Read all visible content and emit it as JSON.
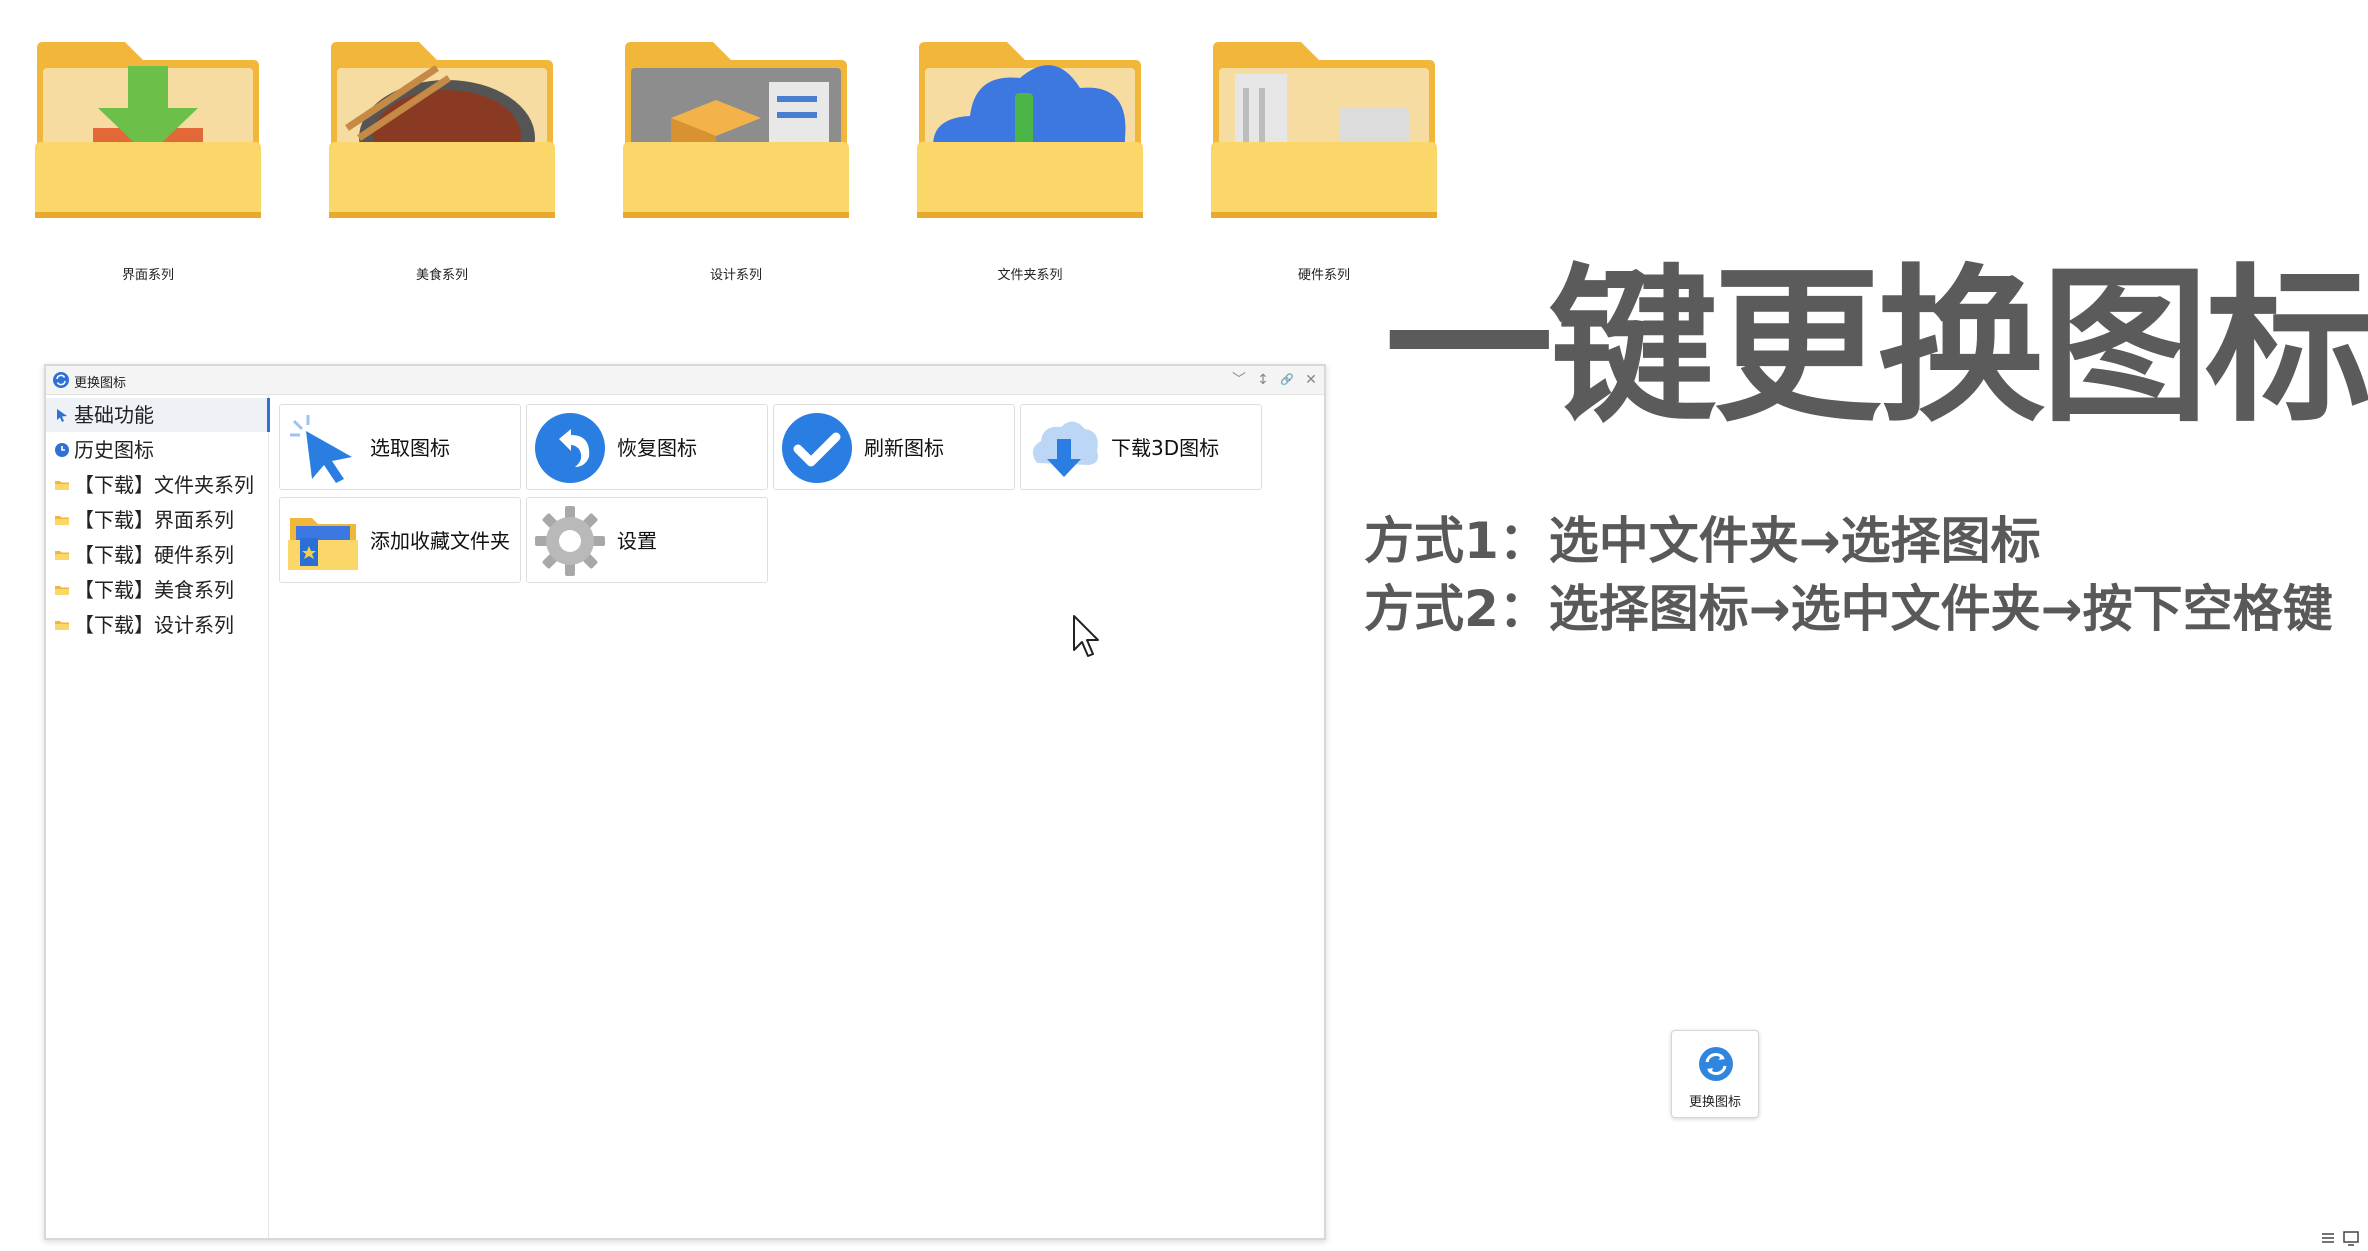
{
  "desktop": {
    "folders": [
      {
        "label": "界面系列",
        "icon": "folder-download-icon"
      },
      {
        "label": "美食系列",
        "icon": "folder-food-icon"
      },
      {
        "label": "设计系列",
        "icon": "folder-design-icon"
      },
      {
        "label": "文件夹系列",
        "icon": "folder-cloud-icon"
      },
      {
        "label": "硬件系列",
        "icon": "folder-hardware-icon"
      }
    ]
  },
  "window": {
    "title": "更换图标",
    "controls": [
      "﹀",
      "↕",
      "🔗",
      "✕"
    ],
    "sidebar": [
      {
        "label": "基础功能",
        "active": true
      },
      {
        "label": "历史图标"
      },
      {
        "label": "【下载】文件夹系列"
      },
      {
        "label": "【下载】界面系列"
      },
      {
        "label": "【下载】硬件系列"
      },
      {
        "label": "【下载】美食系列"
      },
      {
        "label": "【下载】设计系列"
      }
    ],
    "tiles": [
      {
        "label": "选取图标",
        "icon": "cursor-pick-icon"
      },
      {
        "label": "恢复图标",
        "icon": "undo-icon"
      },
      {
        "label": "刷新图标",
        "icon": "check-icon"
      },
      {
        "label": "下载3D图标",
        "icon": "cloud-download-icon"
      },
      {
        "label": "添加收藏文件夹",
        "icon": "favorite-folder-icon"
      },
      {
        "label": "设置",
        "icon": "gear-icon"
      }
    ]
  },
  "promo": {
    "headline": "一键更换图标",
    "method1": "方式1：选中文件夹→选择图标",
    "method2": "方式2：选择图标→选中文件夹→按下空格键"
  },
  "widget": {
    "label": "更换图标"
  },
  "colors": {
    "folder": "#f7c948",
    "accent": "#2f6fd6",
    "headline": "#5b5b5b"
  }
}
